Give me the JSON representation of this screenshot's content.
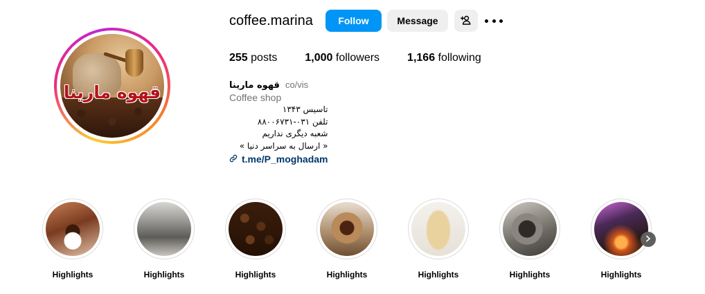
{
  "profile": {
    "username": "coffee.marina",
    "avatar_text": "قهوه مارینا",
    "follow_label": "Follow",
    "message_label": "Message"
  },
  "stats": {
    "posts_count": "255",
    "posts_label": "posts",
    "followers_count": "1,000",
    "followers_label": "followers",
    "following_count": "1,166",
    "following_label": "following"
  },
  "bio": {
    "name": "قهوه مارینا",
    "pronouns": "co/vis",
    "category": "Coffee shop",
    "lines": [
      "تاسیس ۱۳۴۳",
      "تلفن ۰۳۱-۸۸۰۰۶۷۳۱",
      "شعبه دیگری نداریم",
      "« ارسال به سراسر دنیا »"
    ],
    "link": "t.me/P_moghadam"
  },
  "highlights": [
    {
      "label": "Highlights"
    },
    {
      "label": "Highlights"
    },
    {
      "label": "Highlights"
    },
    {
      "label": "Highlights"
    },
    {
      "label": "Highlights"
    },
    {
      "label": "Highlights"
    },
    {
      "label": "Highlights"
    }
  ],
  "colors": {
    "follow_button": "#0095f6",
    "secondary_button": "#efefef",
    "link": "#00376b",
    "muted_text": "#737373"
  },
  "icons": {
    "add_user": "add-user-icon",
    "more": "more-options-icon",
    "link": "link-icon",
    "next": "chevron-right-icon"
  }
}
